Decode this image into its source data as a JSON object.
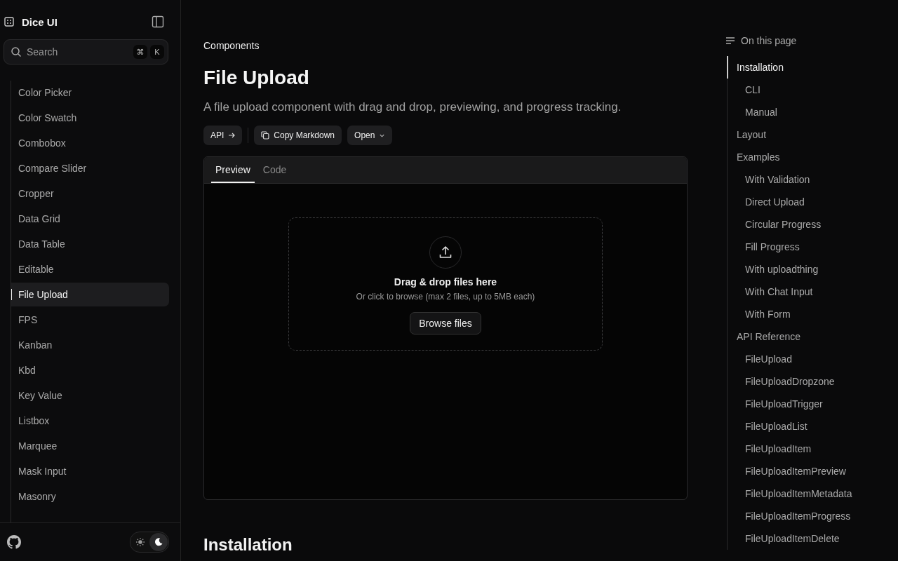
{
  "sidebar": {
    "brand": "Dice UI",
    "search": {
      "placeholder": "Search",
      "shortcut": [
        "⌘",
        "K"
      ]
    },
    "items": [
      {
        "label": "Color Picker",
        "selected": false
      },
      {
        "label": "Color Swatch",
        "selected": false
      },
      {
        "label": "Combobox",
        "selected": false
      },
      {
        "label": "Compare Slider",
        "selected": false
      },
      {
        "label": "Cropper",
        "selected": false
      },
      {
        "label": "Data Grid",
        "selected": false
      },
      {
        "label": "Data Table",
        "selected": false
      },
      {
        "label": "Editable",
        "selected": false
      },
      {
        "label": "File Upload",
        "selected": true
      },
      {
        "label": "FPS",
        "selected": false
      },
      {
        "label": "Kanban",
        "selected": false
      },
      {
        "label": "Kbd",
        "selected": false
      },
      {
        "label": "Key Value",
        "selected": false
      },
      {
        "label": "Listbox",
        "selected": false
      },
      {
        "label": "Marquee",
        "selected": false
      },
      {
        "label": "Mask Input",
        "selected": false
      },
      {
        "label": "Masonry",
        "selected": false
      }
    ],
    "theme": [
      {
        "kind": "light",
        "selected": false
      },
      {
        "kind": "dark",
        "selected": true
      }
    ]
  },
  "main": {
    "breadcrumb": "Components",
    "title": "File Upload",
    "description": "A file upload component with drag and drop, previewing, and progress tracking.",
    "actions": [
      {
        "kind": "api",
        "label": "API"
      },
      {
        "kind": "copy",
        "label": "Copy Markdown"
      },
      {
        "kind": "open",
        "label": "Open"
      }
    ],
    "tabs": [
      {
        "label": "Preview",
        "selected": true
      },
      {
        "label": "Code",
        "selected": false
      }
    ],
    "dropzone": {
      "title": "Drag & drop files here",
      "hint": "Or click to browse (max 2 files, up to 5MB each)",
      "button": "Browse files"
    },
    "section_heading": "Installation"
  },
  "toc": {
    "title": "On this page",
    "items": [
      {
        "label": "Installation",
        "selected": true,
        "children": [
          {
            "label": "CLI",
            "selected": false
          },
          {
            "label": "Manual",
            "selected": false
          }
        ]
      },
      {
        "label": "Layout",
        "selected": false
      },
      {
        "label": "Examples",
        "selected": false,
        "children": [
          {
            "label": "With Validation",
            "selected": false
          },
          {
            "label": "Direct Upload",
            "selected": false
          },
          {
            "label": "Circular Progress",
            "selected": false
          },
          {
            "label": "Fill Progress",
            "selected": false
          },
          {
            "label": "With uploadthing",
            "selected": false
          },
          {
            "label": "With Chat Input",
            "selected": false
          },
          {
            "label": "With Form",
            "selected": false
          }
        ]
      },
      {
        "label": "API Reference",
        "selected": false,
        "children": [
          {
            "label": "FileUpload",
            "selected": false
          },
          {
            "label": "FileUploadDropzone",
            "selected": false
          },
          {
            "label": "FileUploadTrigger",
            "selected": false
          },
          {
            "label": "FileUploadList",
            "selected": false
          },
          {
            "label": "FileUploadItem",
            "selected": false
          },
          {
            "label": "FileUploadItemPreview",
            "selected": false
          },
          {
            "label": "FileUploadItemMetadata",
            "selected": false
          },
          {
            "label": "FileUploadItemProgress",
            "selected": false
          },
          {
            "label": "FileUploadItemDelete",
            "selected": false
          }
        ]
      }
    ]
  }
}
